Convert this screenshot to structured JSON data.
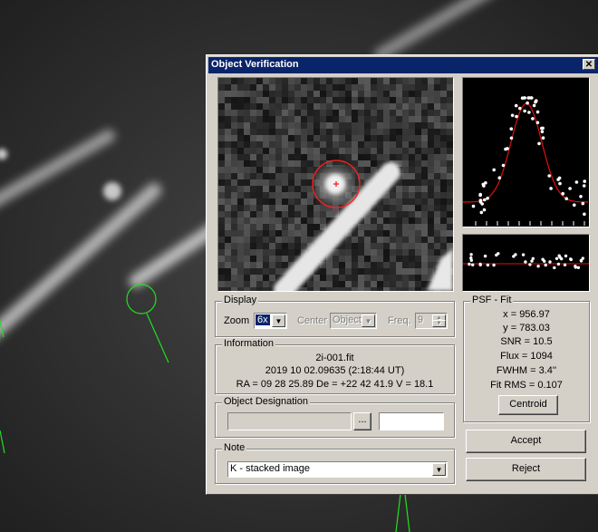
{
  "dialog": {
    "title": "Object Verification",
    "close_glyph": "✕"
  },
  "display": {
    "legend": "Display",
    "zoom_label": "Zoom",
    "zoom_value": "6x",
    "center_label": "Center",
    "center_value": "Object",
    "freq_label": "Freq.",
    "freq_value": "9"
  },
  "information": {
    "legend": "Information",
    "filename": "2i-001.fit",
    "datetime": "2019 10 02.09635 (2:18:44 UT)",
    "coords": "RA = 09 28 25.89   De = +22 42 41.9   V = 18.1"
  },
  "designation": {
    "legend": "Object Designation",
    "browse_label": "...",
    "value": ""
  },
  "note": {
    "legend": "Note",
    "value": "K - stacked image"
  },
  "psf": {
    "legend": "PSF - Fit",
    "x": "x = 956.97",
    "y": "y = 783.03",
    "snr": "SNR = 10.5",
    "flux": "Flux = 1094",
    "fwhm": "FWHM = 3.4''",
    "fit_rms": "Fit RMS = 0.107",
    "centroid_label": "Centroid"
  },
  "buttons": {
    "accept": "Accept",
    "reject": "Reject"
  },
  "colors": {
    "titlebar": "#0a246a",
    "dialog_face": "#d4d0c8",
    "aperture": "#ff2020",
    "psf_curve": "#e01010",
    "marker": "#20e020"
  },
  "icons": {
    "close": "close-icon",
    "dropdown": "chevron-down-icon",
    "spinner_up": "triangle-up-icon",
    "spinner_down": "triangle-down-icon"
  }
}
